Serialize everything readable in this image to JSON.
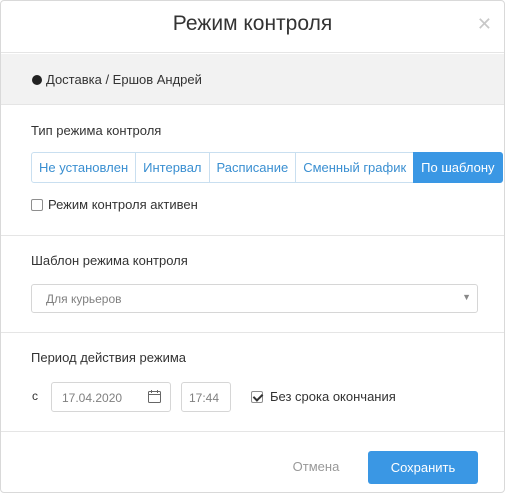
{
  "dialog": {
    "title": "Режим контроля",
    "close_icon": "close-icon"
  },
  "context": {
    "text": "Доставка / Ершов Андрей"
  },
  "mode": {
    "section_title": "Тип режима контроля",
    "options": [
      "Не установлен",
      "Интервал",
      "Расписание",
      "Сменный график",
      "По шаблону"
    ],
    "selected": "По шаблону",
    "active_checkbox_label": "Режим контроля активен",
    "active_checked": false
  },
  "template": {
    "section_title": "Шаблон режима контроля",
    "selected_value": "Для курьеров"
  },
  "period": {
    "section_title": "Период действия режима",
    "from_label": "с",
    "date_value": "17.04.2020",
    "time_value": "17:44",
    "no_end_label": "Без срока окончания",
    "no_end_checked": true
  },
  "footer": {
    "cancel_label": "Отмена",
    "save_label": "Сохранить"
  },
  "colors": {
    "accent": "#3a97e4",
    "segment_text": "#3a8fd1",
    "context_bg": "#f2f2f2"
  }
}
